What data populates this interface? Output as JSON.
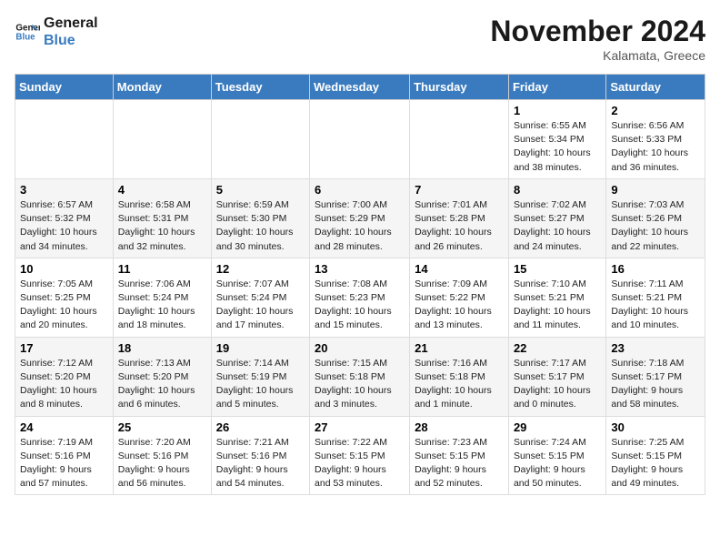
{
  "header": {
    "logo_line1": "General",
    "logo_line2": "Blue",
    "month_title": "November 2024",
    "location": "Kalamata, Greece"
  },
  "weekdays": [
    "Sunday",
    "Monday",
    "Tuesday",
    "Wednesday",
    "Thursday",
    "Friday",
    "Saturday"
  ],
  "weeks": [
    [
      {
        "day": "",
        "info": ""
      },
      {
        "day": "",
        "info": ""
      },
      {
        "day": "",
        "info": ""
      },
      {
        "day": "",
        "info": ""
      },
      {
        "day": "",
        "info": ""
      },
      {
        "day": "1",
        "info": "Sunrise: 6:55 AM\nSunset: 5:34 PM\nDaylight: 10 hours\nand 38 minutes."
      },
      {
        "day": "2",
        "info": "Sunrise: 6:56 AM\nSunset: 5:33 PM\nDaylight: 10 hours\nand 36 minutes."
      }
    ],
    [
      {
        "day": "3",
        "info": "Sunrise: 6:57 AM\nSunset: 5:32 PM\nDaylight: 10 hours\nand 34 minutes."
      },
      {
        "day": "4",
        "info": "Sunrise: 6:58 AM\nSunset: 5:31 PM\nDaylight: 10 hours\nand 32 minutes."
      },
      {
        "day": "5",
        "info": "Sunrise: 6:59 AM\nSunset: 5:30 PM\nDaylight: 10 hours\nand 30 minutes."
      },
      {
        "day": "6",
        "info": "Sunrise: 7:00 AM\nSunset: 5:29 PM\nDaylight: 10 hours\nand 28 minutes."
      },
      {
        "day": "7",
        "info": "Sunrise: 7:01 AM\nSunset: 5:28 PM\nDaylight: 10 hours\nand 26 minutes."
      },
      {
        "day": "8",
        "info": "Sunrise: 7:02 AM\nSunset: 5:27 PM\nDaylight: 10 hours\nand 24 minutes."
      },
      {
        "day": "9",
        "info": "Sunrise: 7:03 AM\nSunset: 5:26 PM\nDaylight: 10 hours\nand 22 minutes."
      }
    ],
    [
      {
        "day": "10",
        "info": "Sunrise: 7:05 AM\nSunset: 5:25 PM\nDaylight: 10 hours\nand 20 minutes."
      },
      {
        "day": "11",
        "info": "Sunrise: 7:06 AM\nSunset: 5:24 PM\nDaylight: 10 hours\nand 18 minutes."
      },
      {
        "day": "12",
        "info": "Sunrise: 7:07 AM\nSunset: 5:24 PM\nDaylight: 10 hours\nand 17 minutes."
      },
      {
        "day": "13",
        "info": "Sunrise: 7:08 AM\nSunset: 5:23 PM\nDaylight: 10 hours\nand 15 minutes."
      },
      {
        "day": "14",
        "info": "Sunrise: 7:09 AM\nSunset: 5:22 PM\nDaylight: 10 hours\nand 13 minutes."
      },
      {
        "day": "15",
        "info": "Sunrise: 7:10 AM\nSunset: 5:21 PM\nDaylight: 10 hours\nand 11 minutes."
      },
      {
        "day": "16",
        "info": "Sunrise: 7:11 AM\nSunset: 5:21 PM\nDaylight: 10 hours\nand 10 minutes."
      }
    ],
    [
      {
        "day": "17",
        "info": "Sunrise: 7:12 AM\nSunset: 5:20 PM\nDaylight: 10 hours\nand 8 minutes."
      },
      {
        "day": "18",
        "info": "Sunrise: 7:13 AM\nSunset: 5:20 PM\nDaylight: 10 hours\nand 6 minutes."
      },
      {
        "day": "19",
        "info": "Sunrise: 7:14 AM\nSunset: 5:19 PM\nDaylight: 10 hours\nand 5 minutes."
      },
      {
        "day": "20",
        "info": "Sunrise: 7:15 AM\nSunset: 5:18 PM\nDaylight: 10 hours\nand 3 minutes."
      },
      {
        "day": "21",
        "info": "Sunrise: 7:16 AM\nSunset: 5:18 PM\nDaylight: 10 hours\nand 1 minute."
      },
      {
        "day": "22",
        "info": "Sunrise: 7:17 AM\nSunset: 5:17 PM\nDaylight: 10 hours\nand 0 minutes."
      },
      {
        "day": "23",
        "info": "Sunrise: 7:18 AM\nSunset: 5:17 PM\nDaylight: 9 hours\nand 58 minutes."
      }
    ],
    [
      {
        "day": "24",
        "info": "Sunrise: 7:19 AM\nSunset: 5:16 PM\nDaylight: 9 hours\nand 57 minutes."
      },
      {
        "day": "25",
        "info": "Sunrise: 7:20 AM\nSunset: 5:16 PM\nDaylight: 9 hours\nand 56 minutes."
      },
      {
        "day": "26",
        "info": "Sunrise: 7:21 AM\nSunset: 5:16 PM\nDaylight: 9 hours\nand 54 minutes."
      },
      {
        "day": "27",
        "info": "Sunrise: 7:22 AM\nSunset: 5:15 PM\nDaylight: 9 hours\nand 53 minutes."
      },
      {
        "day": "28",
        "info": "Sunrise: 7:23 AM\nSunset: 5:15 PM\nDaylight: 9 hours\nand 52 minutes."
      },
      {
        "day": "29",
        "info": "Sunrise: 7:24 AM\nSunset: 5:15 PM\nDaylight: 9 hours\nand 50 minutes."
      },
      {
        "day": "30",
        "info": "Sunrise: 7:25 AM\nSunset: 5:15 PM\nDaylight: 9 hours\nand 49 minutes."
      }
    ]
  ]
}
